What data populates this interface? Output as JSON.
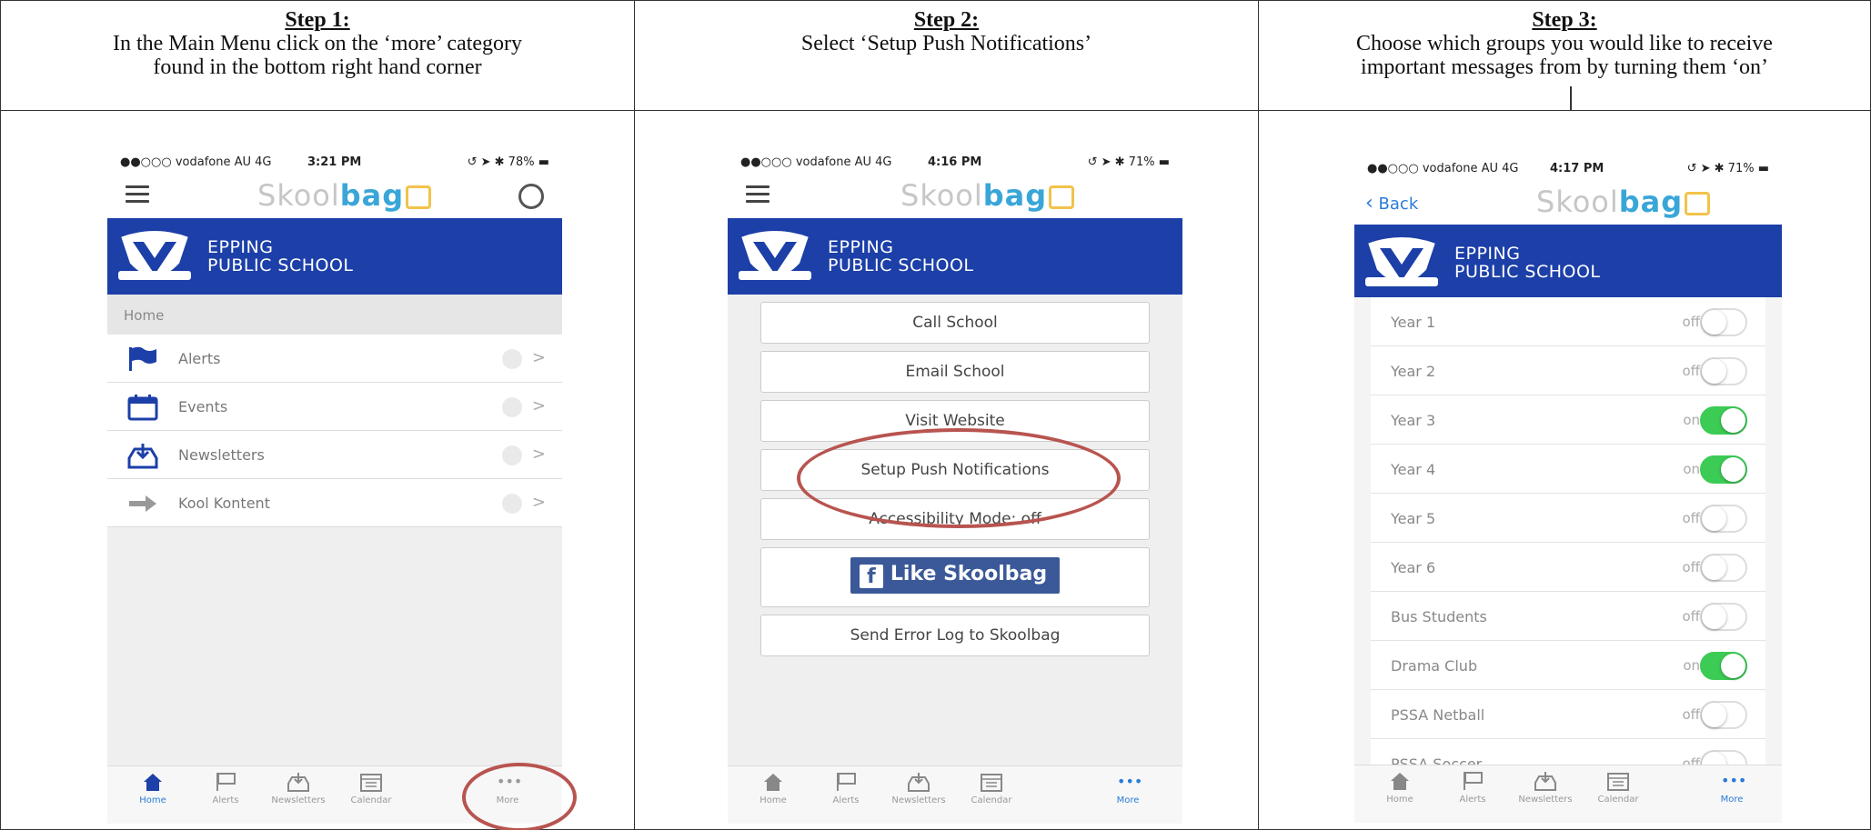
{
  "steps": [
    {
      "title": "Step 1:",
      "line1": "In the Main Menu click on the ‘more’ category",
      "line2": "found in the bottom right hand corner"
    },
    {
      "title": "Step 2:",
      "line1": "Select ‘Setup Push Notifications’",
      "line2": ""
    },
    {
      "title": "Step 3:",
      "line1": "Choose which groups you would like to receive",
      "line2": "important messages from by turning them ‘on’"
    }
  ],
  "phones": [
    {
      "carrier": "●●○○○ vodafone AU  4G",
      "time": "3:21 PM",
      "battery": "78%"
    },
    {
      "carrier": "●●○○○ vodafone AU  4G",
      "time": "4:16 PM",
      "battery": "71%"
    },
    {
      "carrier": "●●○○○ vodafone AU  4G",
      "time": "4:17 PM",
      "battery": "71%"
    }
  ],
  "app": {
    "logo_light": "Skool",
    "logo_bold": "bag",
    "school_line1": "EPPING",
    "school_line2": "PUBLIC SCHOOL",
    "back": "Back"
  },
  "menu": {
    "crumb": "Home",
    "items": [
      "Alerts",
      "Events",
      "Newsletters",
      "Kool Kontent"
    ]
  },
  "more_buttons": [
    "Call School",
    "Email School",
    "Visit Website",
    "Setup Push Notifications",
    "Accessibility Mode: off",
    "Like Skoolbag",
    "Send Error Log to Skoolbag"
  ],
  "groups": [
    {
      "name": "Year 1",
      "state": "off"
    },
    {
      "name": "Year 2",
      "state": "off"
    },
    {
      "name": "Year 3",
      "state": "on"
    },
    {
      "name": "Year 4",
      "state": "on"
    },
    {
      "name": "Year 5",
      "state": "off"
    },
    {
      "name": "Year 6",
      "state": "off"
    },
    {
      "name": "Bus Students",
      "state": "off"
    },
    {
      "name": "Drama Club",
      "state": "on"
    },
    {
      "name": "PSSA Netball",
      "state": "off"
    },
    {
      "name": "PSSA Soccer",
      "state": "off"
    }
  ],
  "tabs": [
    "Home",
    "Alerts",
    "Newsletters",
    "Calendar",
    "More"
  ],
  "colors": {
    "banner": "#1c3fa8",
    "toggle_on": "#3ccb55",
    "highlight": "#b85450",
    "link": "#2a7bd8"
  }
}
